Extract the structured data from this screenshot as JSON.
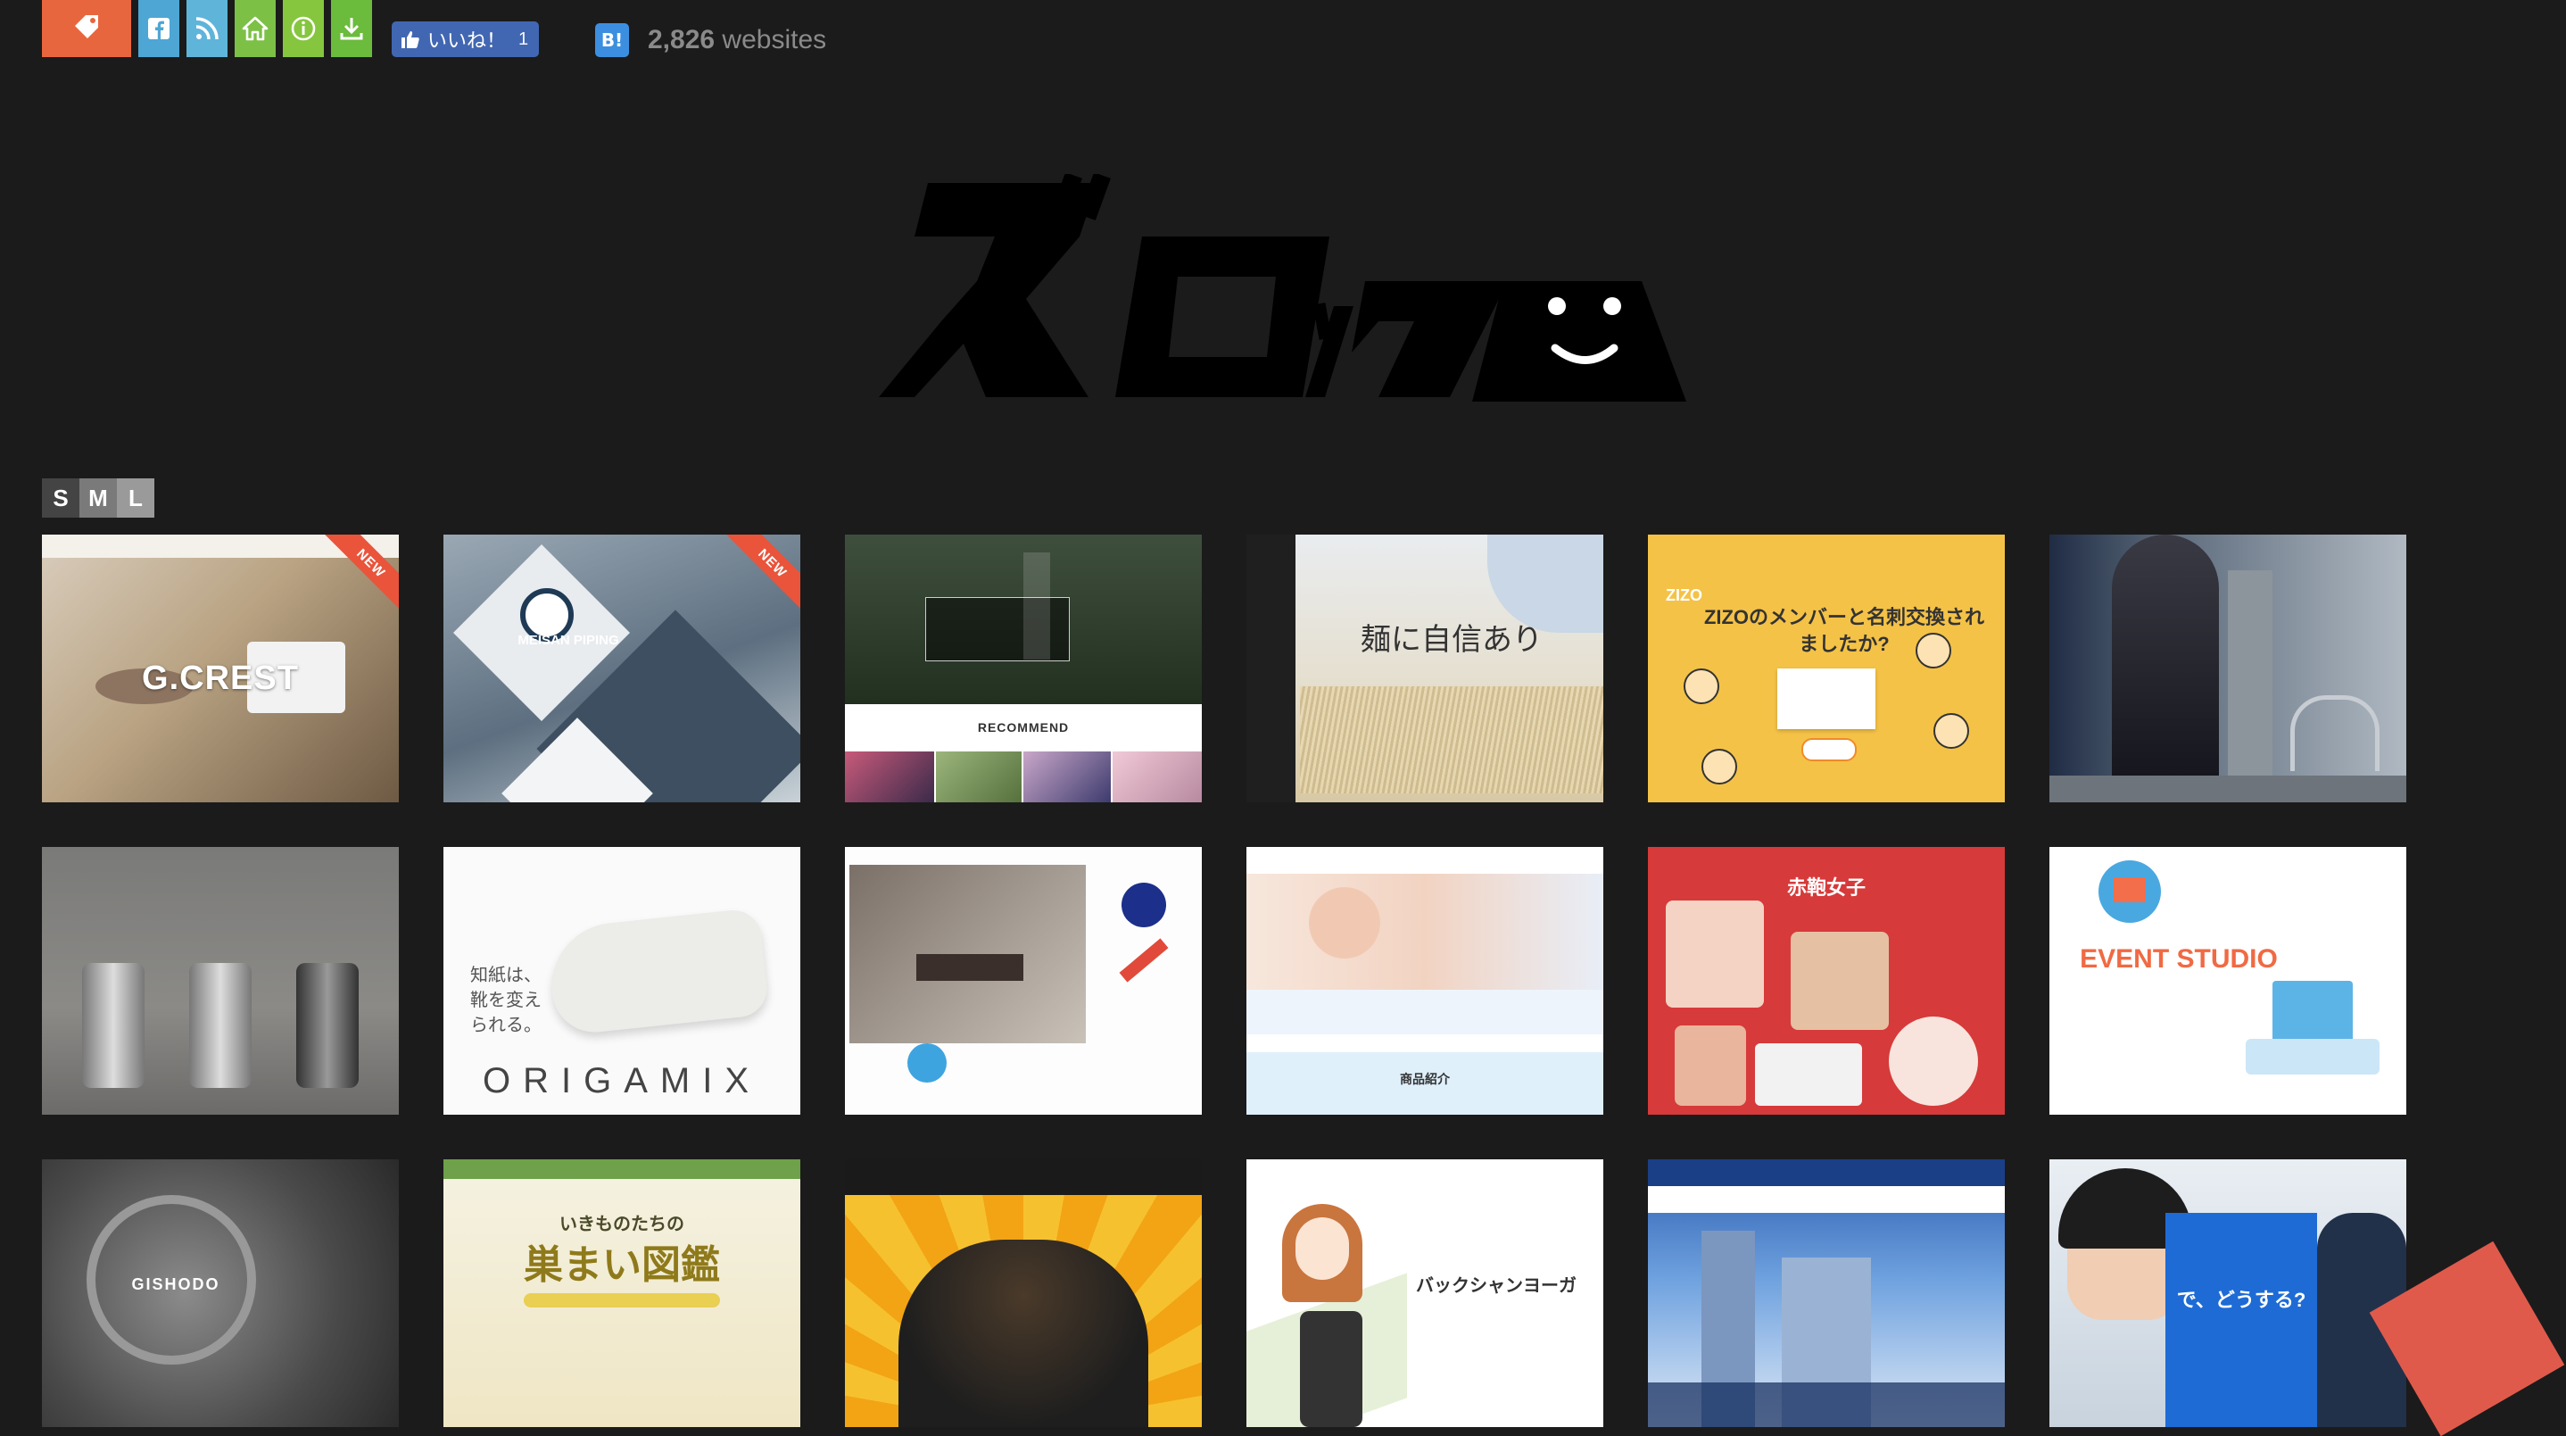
{
  "topbar": {
    "like_label": "いいね！",
    "like_count": "1",
    "hatena_label": "B!",
    "site_count_number": "2,826",
    "site_count_suffix": "websites"
  },
  "logo": {
    "text": "ズロック"
  },
  "size_switch": {
    "s": "S",
    "m": "M",
    "l": "L"
  },
  "cards": {
    "c1": {
      "caption": "G.CREST",
      "badge": "NEW"
    },
    "c2": {
      "caption": "MEISAN PIPING",
      "badge": "NEW"
    },
    "c3": {
      "caption": "RECOMMEND"
    },
    "c4": {
      "caption": "麺に自信あり"
    },
    "c5": {
      "caption": "ZIZOのメンバーと名刺交換されましたか?",
      "sub": "ZIZO"
    },
    "c6": {
      "caption": ""
    },
    "c7": {
      "caption": ""
    },
    "c8": {
      "caption": "ORIGAMIX",
      "sub": "知紙は、靴を変えられる。"
    },
    "c9": {
      "caption": ""
    },
    "c10": {
      "caption": "商品紹介"
    },
    "c11": {
      "caption": "赤鞄女子"
    },
    "c12": {
      "caption": "EVENT STUDIO"
    },
    "c13": {
      "caption": "GISHODO"
    },
    "c14": {
      "caption": "巣まい図鑑",
      "sub": "いきものたちの"
    },
    "c15": {
      "caption": ""
    },
    "c16": {
      "caption": "バックシャンヨーガ"
    },
    "c17": {
      "caption": ""
    },
    "c18": {
      "caption": "で、どうする?"
    }
  }
}
